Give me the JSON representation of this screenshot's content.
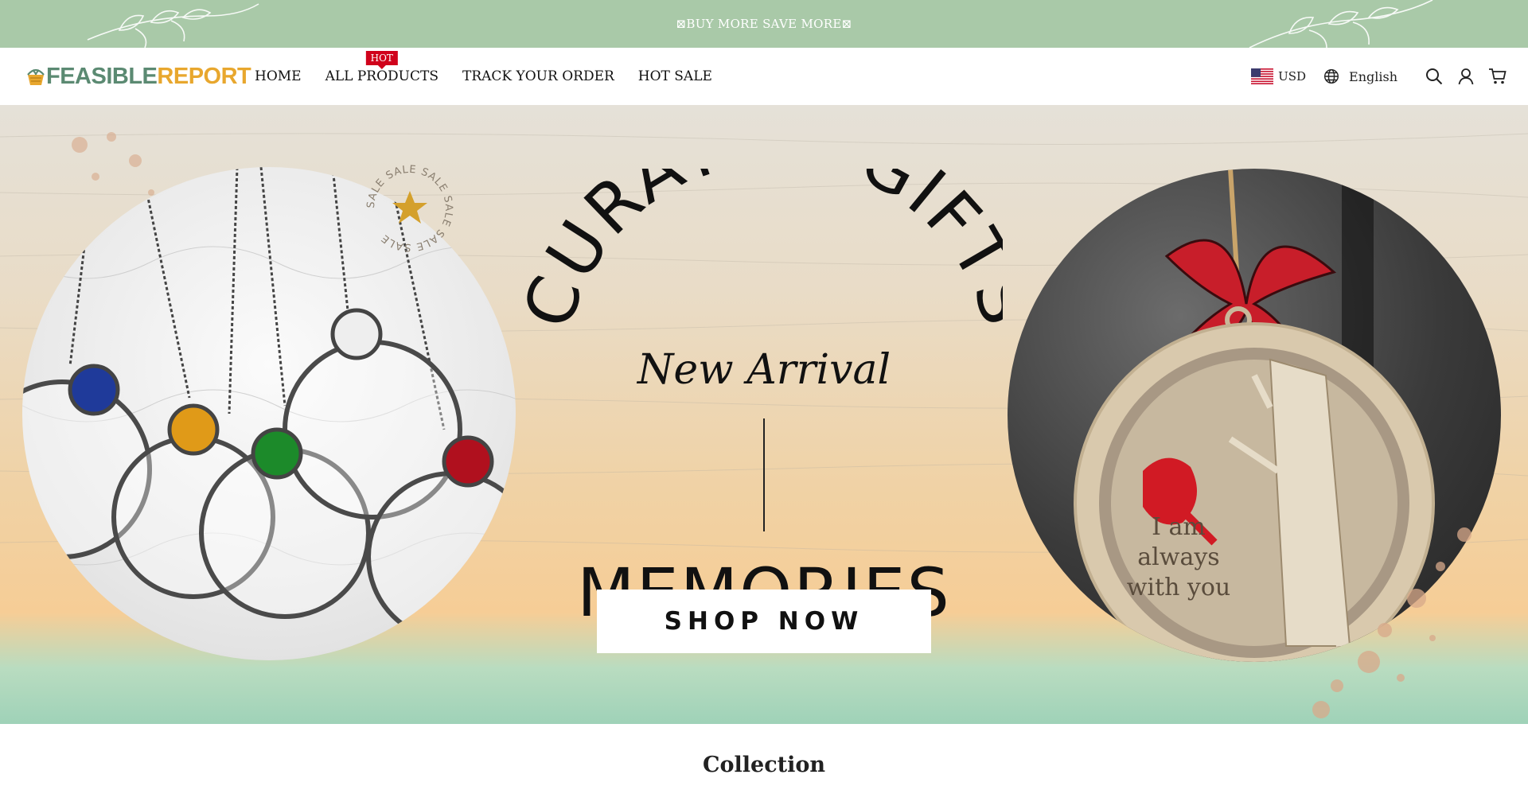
{
  "announcement": {
    "text": "⊠BUY MORE SAVE MORE⊠"
  },
  "header": {
    "logo": {
      "part1": "FEASIBLE",
      "part2": "REPORT"
    },
    "nav": [
      {
        "label": "HOME"
      },
      {
        "label": "ALL PRODUCTS",
        "badge": "HOT"
      },
      {
        "label": "TRACK YOUR ORDER"
      },
      {
        "label": "HOT SALE"
      }
    ],
    "currency": "USD",
    "language": "English",
    "icons": [
      "us-flag-icon",
      "globe-icon",
      "search-icon",
      "account-icon",
      "cart-icon"
    ]
  },
  "hero": {
    "arc_text": "CURATED GIFTS",
    "script_text": "New Arrival",
    "main_text": "MEMORIES",
    "button_label": "SHOP NOW",
    "sale_ring_text": "SALE SALE SALE SALE SALE SALE",
    "ornament_text": [
      "I am",
      "always",
      "with you"
    ]
  },
  "collection": {
    "title": "Collection"
  },
  "colors": {
    "announce_bg": "#a9c9a8",
    "logo_green": "#5b8a72",
    "logo_gold": "#e8a72e",
    "hot_badge": "#d0021b"
  }
}
